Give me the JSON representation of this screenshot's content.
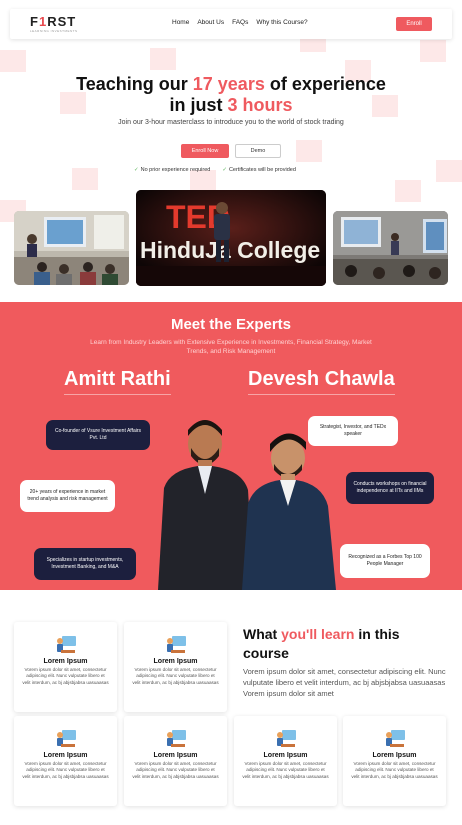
{
  "nav": {
    "logo_pre": "F",
    "logo_mid": "1",
    "logo_post": "RST",
    "logo_tag": "LEARNING INVESTMENTS",
    "links": [
      "Home",
      "About Us",
      "FAQs",
      "Why this Course?"
    ],
    "cta": "Enroll"
  },
  "hero": {
    "title_a": "Teaching our ",
    "title_hl1": "17 years",
    "title_b": " of experience",
    "title_c": "in just ",
    "title_hl2": "3 hours",
    "subtitle": "Join our 3-hour masterclass to introduce you to the world of stock trading",
    "btn_primary": "Enroll Now",
    "btn_secondary": "Demo",
    "check_1": "No prior experience required",
    "check_2": "Certificates will be provided",
    "center_sign_top": "TED",
    "center_sign_bottom": "HinduJa College"
  },
  "experts": {
    "title": "Meet the Experts",
    "subtitle": "Learn from Industry Leaders with Extensive Experience in Investments, Financial Strategy, Market Trends, and Risk Management",
    "name_1": "Amitt Rathi",
    "name_2": "Devesh Chawla",
    "bubble_1": "Co-founder of Vsure Investment Affairs Pvt. Ltd",
    "bubble_2": "20+ years of experience in market trend analysis and risk management",
    "bubble_3": "Specializes in startup investments, Investment Banking, and M&A",
    "bubble_4": "Strategist, Investor, and TEDx speaker",
    "bubble_5": "Conducts workshops on financial independence at IITs and IIMs",
    "bubble_6": "Recognized as a Forbes Top 100 People Manager"
  },
  "learn": {
    "title_a": "What ",
    "title_hl": "you'll learn",
    "title_b": " in this course",
    "desc": "Vorem ipsum dolor sit amet, consectetur adipiscing elit. Nunc vulputate libero et velit interdum, ac bj abjsbjabsa uasuaasas Vorem ipsum dolor sit amet",
    "cards": [
      {
        "title": "Lorem Ipsum",
        "desc": "Vorem ipsum dolor sit amet, consectetur adipiscing elit. Nunc vulputate libero et velit interdum, ac bj abjsbjabsa uasuaasas"
      },
      {
        "title": "Lorem Ipsum",
        "desc": "Vorem ipsum dolor sit amet, consectetur adipiscing elit. Nunc vulputate libero et velit interdum, ac bj abjsbjabsa uasuaasas"
      },
      {
        "title": "Lorem Ipsum",
        "desc": "Vorem ipsum dolor sit amet, consectetur adipiscing elit. Nunc vulputate libero et velit interdum, ac bj abjsbjabsa uasuaasas"
      },
      {
        "title": "Lorem Ipsum",
        "desc": "Vorem ipsum dolor sit amet, consectetur adipiscing elit. Nunc vulputate libero et velit interdum, ac bj abjsbjabsa uasuaasas"
      },
      {
        "title": "Lorem Ipsum",
        "desc": "Vorem ipsum dolor sit amet, consectetur adipiscing elit. Nunc vulputate libero et velit interdum, ac bj abjsbjabsa uasuaasas"
      },
      {
        "title": "Lorem Ipsum",
        "desc": "Vorem ipsum dolor sit amet, consectetur adipiscing elit. Nunc vulputate libero et velit interdum, ac bj abjsbjabsa uasuaasas"
      }
    ]
  },
  "colors": {
    "accent": "#ef5a5f",
    "experts_bg": "#f05a5d",
    "bubble_dark": "#1c1f3e"
  },
  "icons": {
    "check": "check-icon",
    "card": "teacher-at-board-icon"
  }
}
